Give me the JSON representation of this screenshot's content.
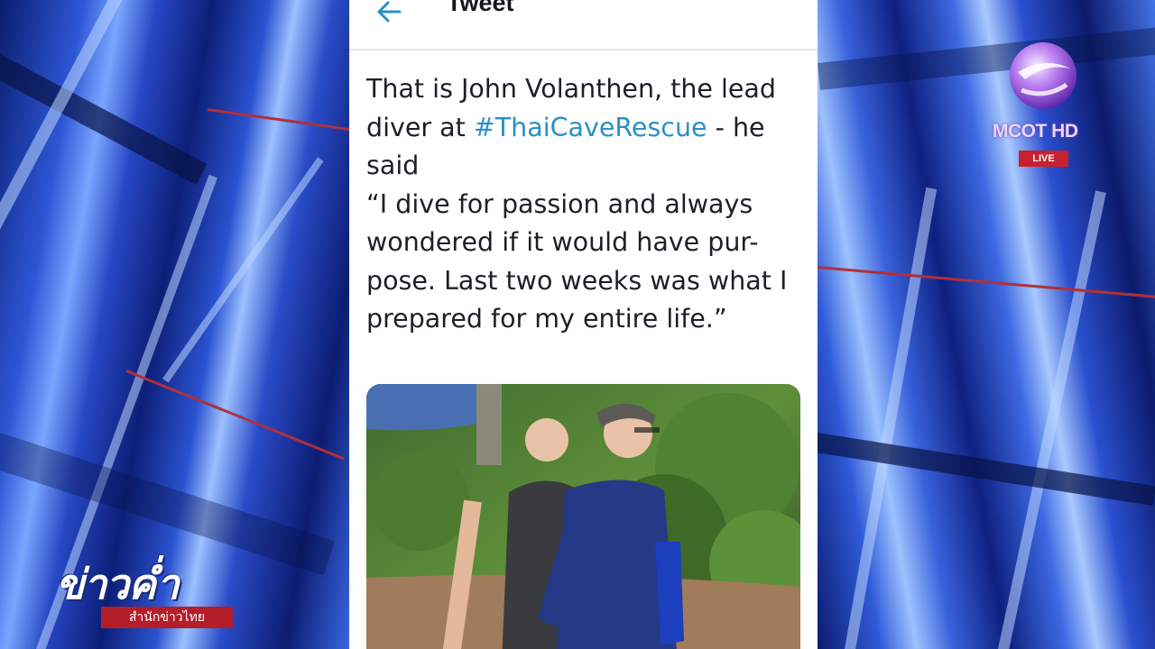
{
  "tweet": {
    "header_title": "Tweet",
    "body_lines": [
      {
        "before": "That is John Volanthen, the lead",
        "hashtag": "",
        "after": ""
      },
      {
        "before": "diver at ",
        "hashtag": "#ThaiCaveRescue",
        "after": " - he"
      },
      {
        "before": "said",
        "hashtag": "",
        "after": ""
      },
      {
        "before": "“I dive for passion and always",
        "hashtag": "",
        "after": ""
      },
      {
        "before": "wondered if it would have pur-",
        "hashtag": "",
        "after": ""
      },
      {
        "before": "pose. Last two weeks was what I",
        "hashtag": "",
        "after": ""
      },
      {
        "before": "prepared for my entire life.”",
        "hashtag": "",
        "after": ""
      }
    ]
  },
  "channel": {
    "name": "MCOT HD",
    "live_label": "LIVE"
  },
  "news_program": {
    "title": "ข่าวค่ำ",
    "subtitle": "สำนักข่าวไทย"
  },
  "colors": {
    "hashtag": "#2a8fc7",
    "back_arrow": "#2a8fc7",
    "live_badge": "#c7202e",
    "news_red": "#b31e28"
  },
  "icons": {
    "back": "back-arrow-icon",
    "channel_logo": "mcot-logo-icon"
  }
}
